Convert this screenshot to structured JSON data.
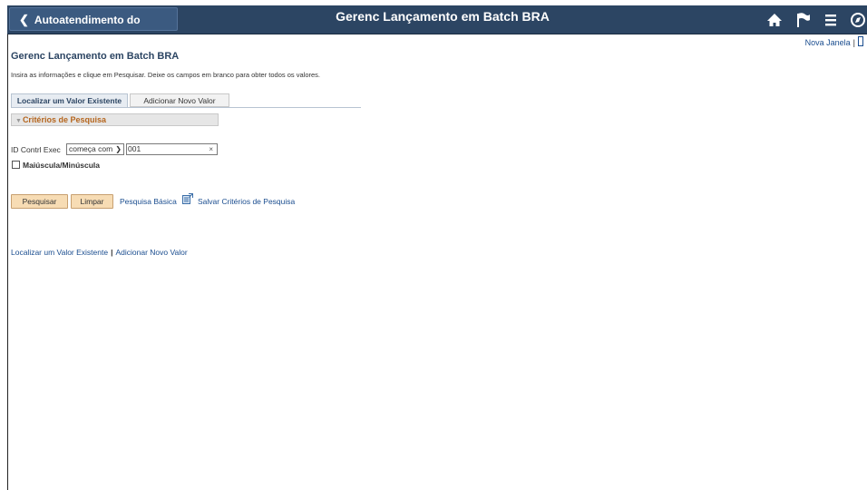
{
  "header": {
    "back_label": "Autoatendimento do Gerente",
    "title": "Gerenc Lançamento em Batch BRA"
  },
  "links": {
    "new_window": "Nova Janela"
  },
  "page": {
    "title": "Gerenc Lançamento em Batch BRA",
    "instructions": "Insira as informações e clique em Pesquisar. Deixe os campos em branco para obter todos os valores."
  },
  "tabs": [
    {
      "label": "Localizar um Valor Existente",
      "active": true
    },
    {
      "label": "Adicionar Novo Valor",
      "active": false
    }
  ],
  "criteria": {
    "section_title": "Critérios de Pesquisa",
    "field_label": "ID Contrl Exec",
    "operator_value": "começa com",
    "input_value": "001",
    "case_label": "Maiúscula/Minúscula",
    "case_checked": false
  },
  "actions": {
    "search": "Pesquisar",
    "clear": "Limpar",
    "basic_search": "Pesquisa Básica",
    "save_criteria": "Salvar Critérios de Pesquisa"
  },
  "bottom_links": {
    "find_existing": "Localizar um Valor Existente",
    "add_new": "Adicionar Novo Valor"
  },
  "colors": {
    "header_bg": "#2c4563",
    "button_bg": "#f7dcb4",
    "link": "#1a4d8f",
    "section_title": "#b5651d"
  }
}
